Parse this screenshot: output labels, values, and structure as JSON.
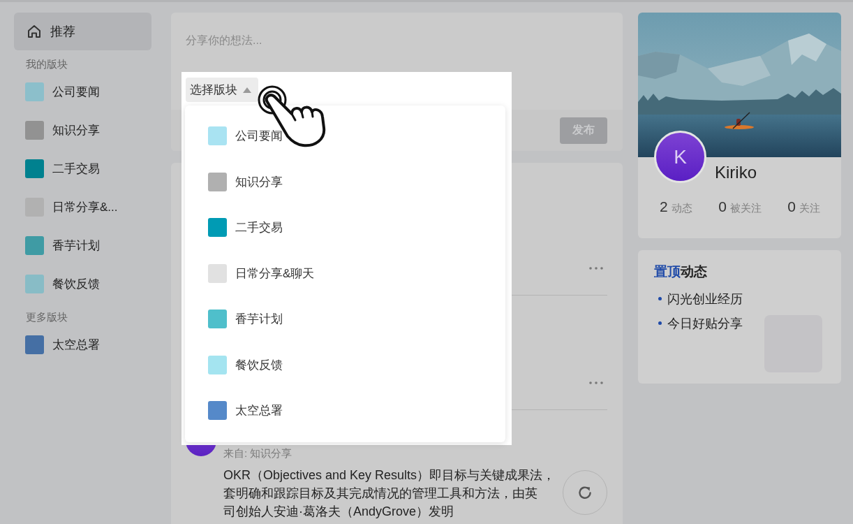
{
  "sidebar": {
    "home": {
      "label": "推荐",
      "selected": true
    },
    "sections": [
      {
        "title": "我的版块",
        "items": [
          {
            "label": "公司要闻",
            "color": "#8cbfcb",
            "selected": false
          },
          {
            "label": "知识分享",
            "color": "#929292",
            "selected": false
          },
          {
            "label": "二手交易",
            "color": "#00818f",
            "selected": false
          },
          {
            "label": "日常分享&...",
            "color": "#b1b1b1",
            "selected": false
          },
          {
            "label": "香芋计划",
            "color": "#3f9ba4",
            "selected": false
          },
          {
            "label": "餐饮反馈",
            "color": "#88bcc6",
            "selected": false
          }
        ]
      },
      {
        "title": "更多版块",
        "items": [
          {
            "label": "太空总署",
            "color": "#456fa4",
            "selected": false
          }
        ]
      }
    ]
  },
  "composer": {
    "placeholder": "分享你的想法...",
    "publish_button": "发布"
  },
  "board_picker": {
    "label": "选择版块",
    "expanded": true,
    "options": [
      {
        "label": "公司要闻",
        "color": "#a9e3f2"
      },
      {
        "label": "知识分享",
        "color": "#b0b0b0"
      },
      {
        "label": "二手交易",
        "color": "#009bb4"
      },
      {
        "label": "日常分享&聊天",
        "color": "#e1e1e1"
      },
      {
        "label": "香芋计划",
        "color": "#4fbfcb"
      },
      {
        "label": "餐饮反馈",
        "color": "#a4e4f0"
      },
      {
        "label": "太空总署",
        "color": "#5589c9"
      }
    ]
  },
  "feed": {
    "posts": [
      {
        "kind": "covered"
      },
      {
        "kind": "covered"
      },
      {
        "kind": "text",
        "source": "来自: 知识分享",
        "body_lines": [
          "OKR（Objectives and Key Results）即目标与关键成果法，",
          "套明确和跟踪目标及其完成情况的管理工具和方法，由英",
          "司创始人安迪·葛洛夫（AndyGrove）发明"
        ]
      }
    ]
  },
  "profile": {
    "avatar_letter": "K",
    "name": "Kiriko",
    "stats": [
      {
        "value": "2",
        "label": "动态"
      },
      {
        "value": "0",
        "label": "被关注"
      },
      {
        "value": "0",
        "label": "关注"
      }
    ]
  },
  "pinned": {
    "title_accent": "置顶",
    "title": "动态",
    "items": [
      "闪光创业经历",
      "今日好贴分享"
    ]
  }
}
